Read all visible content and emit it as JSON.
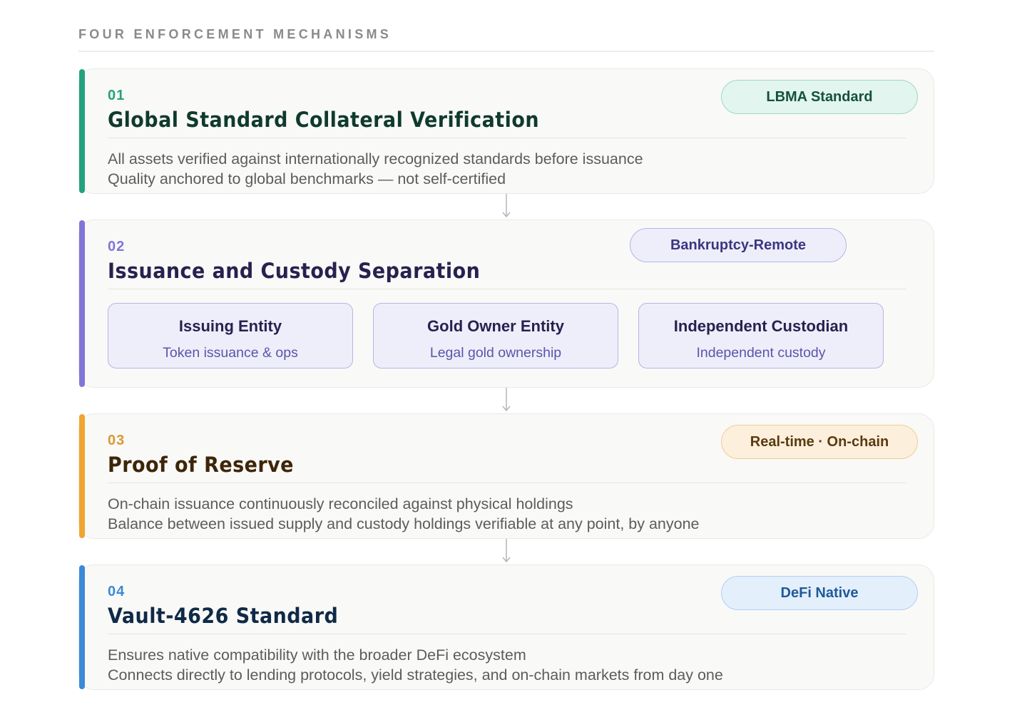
{
  "section": {
    "title": "FOUR ENFORCEMENT MECHANISMS"
  },
  "mechanisms": [
    {
      "number": "01",
      "title": "Global Standard Collateral Verification",
      "badge": "LBMA Standard",
      "lines": [
        "All assets verified against internationally recognized standards before issuance",
        "Quality anchored to global benchmarks — not self-certified"
      ],
      "colors": {
        "accent": "#24a27e",
        "number": "#24a27e",
        "title": "#0f3a2e",
        "badge_bg": "#e2f5ee",
        "badge_border": "#9ed8c2",
        "badge_text": "#14513e"
      }
    },
    {
      "number": "02",
      "title": "Issuance and Custody Separation",
      "badge": "Bankruptcy-Remote",
      "entities": [
        {
          "name": "Issuing Entity",
          "sub": "Token issuance & ops"
        },
        {
          "name": "Gold Owner Entity",
          "sub": "Legal gold ownership"
        },
        {
          "name": "Independent Custodian",
          "sub": "Independent custody"
        }
      ],
      "colors": {
        "accent": "#7f76d8",
        "number": "#7f76d8",
        "title": "#26224f",
        "badge_bg": "#eeeefb",
        "badge_border": "#b7b4e4",
        "badge_text": "#3b3680"
      }
    },
    {
      "number": "03",
      "title": "Proof of Reserve",
      "badge": "Real-time · On-chain",
      "lines": [
        "On-chain issuance continuously reconciled against physical holdings",
        "Balance between issued supply and custody holdings verifiable at any point, by anyone"
      ],
      "colors": {
        "accent": "#f0a530",
        "number": "#d99a33",
        "title": "#3d2508",
        "badge_bg": "#fcefdc",
        "badge_border": "#f0cd95",
        "badge_text": "#5a3a10"
      }
    },
    {
      "number": "04",
      "title": "Vault-4626 Standard",
      "badge": "DeFi Native",
      "lines": [
        "Ensures native compatibility with the broader DeFi ecosystem",
        "Connects directly to lending protocols, yield strategies, and on-chain markets from day one"
      ],
      "colors": {
        "accent": "#3a8ad8",
        "number": "#3a8ad8",
        "title": "#0f2a47",
        "badge_bg": "#e4effc",
        "badge_border": "#b3cff0",
        "badge_text": "#1f5a99"
      }
    }
  ]
}
